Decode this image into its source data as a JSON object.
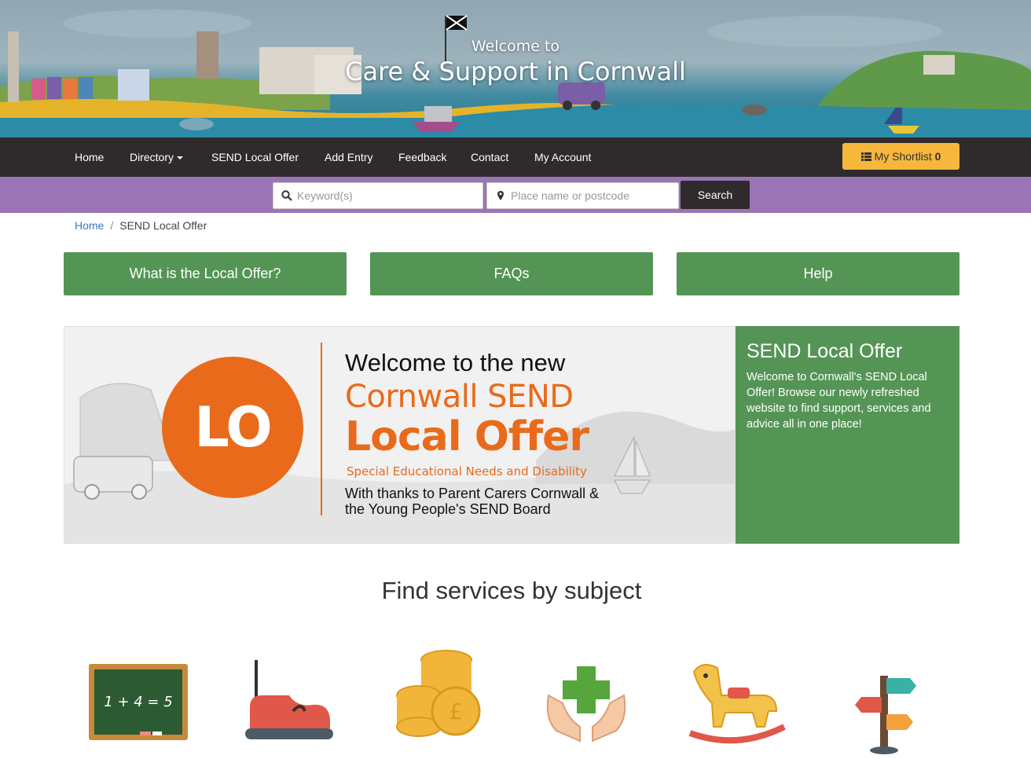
{
  "hero": {
    "welcome": "Welcome to",
    "title": "Care & Support in Cornwall"
  },
  "nav": {
    "items": [
      {
        "label": "Home"
      },
      {
        "label": "Directory"
      },
      {
        "label": "SEND Local Offer"
      },
      {
        "label": "Add Entry"
      },
      {
        "label": "Feedback"
      },
      {
        "label": "Contact"
      },
      {
        "label": "My Account"
      }
    ],
    "shortlist_label": "My Shortlist",
    "shortlist_count": "0"
  },
  "search": {
    "keyword_placeholder": "Keyword(s)",
    "location_placeholder": "Place name or postcode",
    "button_label": "Search"
  },
  "breadcrumb": {
    "home": "Home",
    "separator": "/",
    "current": "SEND Local Offer"
  },
  "quick_links": [
    {
      "label": "What is the Local Offer?"
    },
    {
      "label": "FAQs"
    },
    {
      "label": "Help"
    }
  ],
  "banner": {
    "logo_text": "LO",
    "welcome": "Welcome to the new",
    "line1": "Cornwall SEND",
    "line2": "Local Offer",
    "subtitle": "Special Educational Needs and Disability",
    "thanks": "With thanks to Parent Carers Cornwall & the Young People's SEND Board",
    "accent_color": "#e96a1a"
  },
  "side_panel": {
    "title": "SEND Local Offer",
    "text": "Welcome to Cornwall's SEND Local Offer! Browse our newly refreshed website to find support, services and advice all in one place!"
  },
  "subjects": {
    "title": "Find services by subject",
    "tiles": [
      {
        "icon": "chalkboard-icon",
        "board_text": "1 + 4 = 5"
      },
      {
        "icon": "bumper-car-icon"
      },
      {
        "icon": "coins-icon"
      },
      {
        "icon": "health-hands-icon"
      },
      {
        "icon": "rocking-horse-icon"
      },
      {
        "icon": "signpost-icon"
      }
    ]
  },
  "colors": {
    "nav_bg": "#2f2a2c",
    "search_strip": "#9b74b5",
    "green": "#549555",
    "shortlist": "#f6b73c",
    "link": "#3a79b4"
  }
}
